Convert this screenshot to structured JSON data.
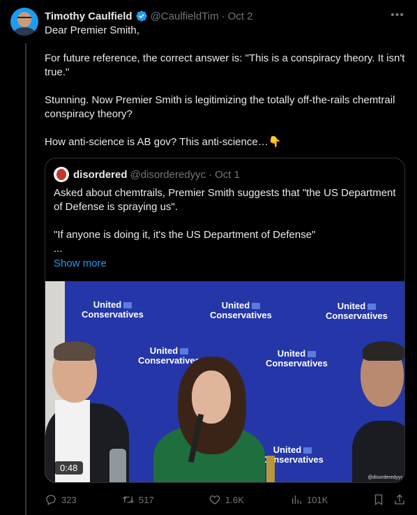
{
  "tweet": {
    "author_name": "Timothy Caulfield",
    "handle": "@CaulfieldTim",
    "separator": "·",
    "date": "Oct 2",
    "more_icon": "more-horizontal-icon",
    "paragraphs": [
      "Dear Premier Smith,",
      "For future reference, the correct answer is: \"This is a conspiracy theory. It isn't true.\"",
      "Stunning. Now Premier Smith is legitimizing the totally off-the-rails chemtrail conspiracy theory?",
      "How anti-science is AB gov? This anti-science…👇"
    ]
  },
  "quote": {
    "author_name": "disordered",
    "handle": "@disorderedyyc",
    "separator": "·",
    "date": "Oct 1",
    "paragraphs": [
      "Asked about chemtrails, Premier Smith suggests that \"the US Department of Defense is spraying us\".",
      "\"If anyone is doing it, it's the US Department of Defense\"",
      "..."
    ],
    "show_more": "Show more",
    "video": {
      "banner_line1": "United",
      "banner_line2": "Conservatives",
      "duration": "0:48",
      "watermark": "@disorderedyyc"
    }
  },
  "actions": {
    "replies": "323",
    "retweets": "517",
    "likes": "1.6K",
    "views": "101K"
  },
  "colors": {
    "background": "#000000",
    "text": "#e7e9ea",
    "muted": "#71767b",
    "link": "#1d9bf0",
    "border": "#2f3336"
  }
}
